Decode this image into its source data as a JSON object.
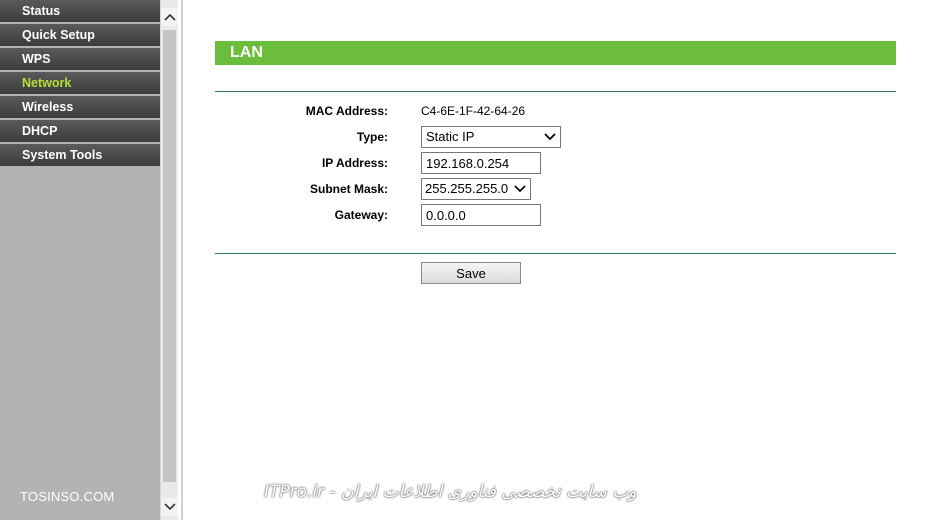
{
  "sidebar": {
    "items": [
      {
        "label": "Status"
      },
      {
        "label": "Quick Setup"
      },
      {
        "label": "WPS"
      },
      {
        "label": "Network"
      },
      {
        "label": "Wireless"
      },
      {
        "label": "DHCP"
      },
      {
        "label": "System Tools"
      }
    ],
    "active": "Network",
    "watermark": "TOSINSO.COM"
  },
  "page": {
    "title": "LAN"
  },
  "form": {
    "mac_label": "MAC Address:",
    "mac_value": "C4-6E-1F-42-64-26",
    "type_label": "Type:",
    "type_value": "Static IP",
    "ip_label": "IP Address:",
    "ip_value": "192.168.0.254",
    "subnet_label": "Subnet Mask:",
    "subnet_value": "255.255.255.0",
    "gateway_label": "Gateway:",
    "gateway_value": "0.0.0.0",
    "save_label": "Save"
  },
  "footer": {
    "watermark": "ITPro.ir - وب سایت تخصصی فناوری اطلاعات ایران"
  },
  "colors": {
    "title_bar": "#6bbd3b",
    "sidebar_bg": "#b3b3b3",
    "nav_item_bg": "#4a4a4a",
    "nav_active_text": "#b4de3a",
    "divider_line": "#2f7a5a"
  },
  "icons": {
    "scroll_up": "chevron-up-icon",
    "scroll_down": "chevron-down-icon",
    "dropdown": "chevron-down-icon"
  }
}
